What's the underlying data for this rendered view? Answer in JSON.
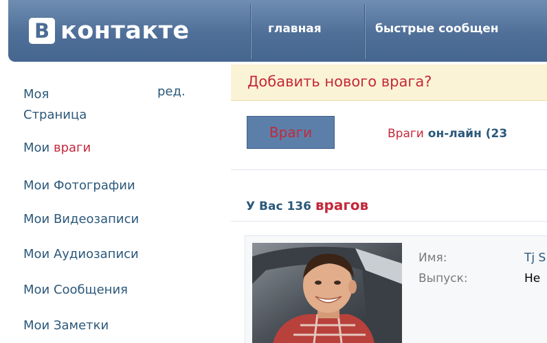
{
  "header": {
    "logo_letter": "В",
    "logo_text": "контакте",
    "nav": [
      "главная",
      "быстрые сообщен"
    ]
  },
  "sidebar": {
    "items": [
      {
        "label": "Моя\nСтраница",
        "edit": "ред."
      },
      {
        "label": "Мои ",
        "highlight": "враги"
      },
      {
        "label": "Мои Фотографии"
      },
      {
        "label": "Мои Видеозаписи"
      },
      {
        "label": "Мои Аудиозаписи"
      },
      {
        "label": "Мои Сообщения"
      },
      {
        "label": "Мои Заметки"
      }
    ]
  },
  "main": {
    "notice": "Добавить нового врага?",
    "tabs": {
      "active": "Враги",
      "online_label": "Враги",
      "online_rest": " он-лайн (23"
    },
    "count": {
      "prefix": "У Вас 136 ",
      "word": "врагов"
    },
    "profile": {
      "fields": [
        {
          "label": "Имя:",
          "value": "Tj S"
        },
        {
          "label": "Выпуск:",
          "value": "Не"
        }
      ]
    }
  },
  "colors": {
    "header_blue": "#4f6f98",
    "link_blue": "#2b587a",
    "accent_red": "#c4283a",
    "notice_bg": "#fbf3d6"
  }
}
